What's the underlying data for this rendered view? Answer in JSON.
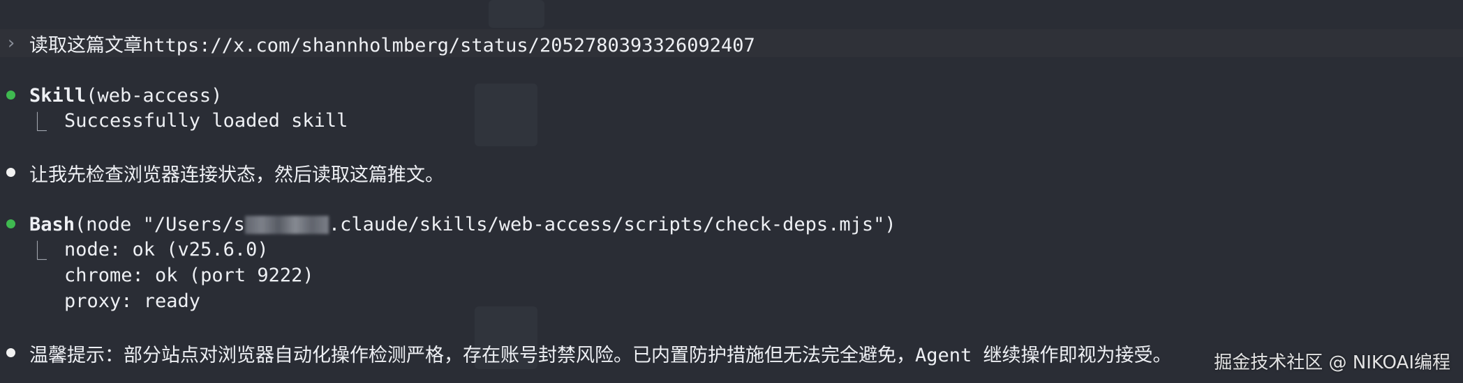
{
  "prompt": {
    "caret": "›",
    "text": "读取这篇文章https://x.com/shannholmberg/status/2052780393326092407"
  },
  "skill_call": {
    "name": "Skill",
    "args": "(web-access)",
    "result": "Successfully loaded skill",
    "status_color": "#3fb950"
  },
  "message_1": {
    "text": "让我先检查浏览器连接状态，然后读取这篇推文。"
  },
  "bash_call": {
    "name": "Bash",
    "args_before": "(node \"/Users/s",
    "args_after": ".claude/skills/web-access/scripts/check-deps.mjs\")",
    "status_color": "#3fb950",
    "output": [
      "node: ok (v25.6.0)",
      "chrome: ok (port 9222)",
      "proxy: ready"
    ]
  },
  "message_2": {
    "text": "温馨提示：部分站点对浏览器自动化操作检测严格，存在账号封禁风险。已内置防护措施但无法完全避免，Agent 继续操作即视为接受。"
  },
  "elbow_glyph": "⎿",
  "watermark": "掘金技术社区 @ NIKOAI编程"
}
